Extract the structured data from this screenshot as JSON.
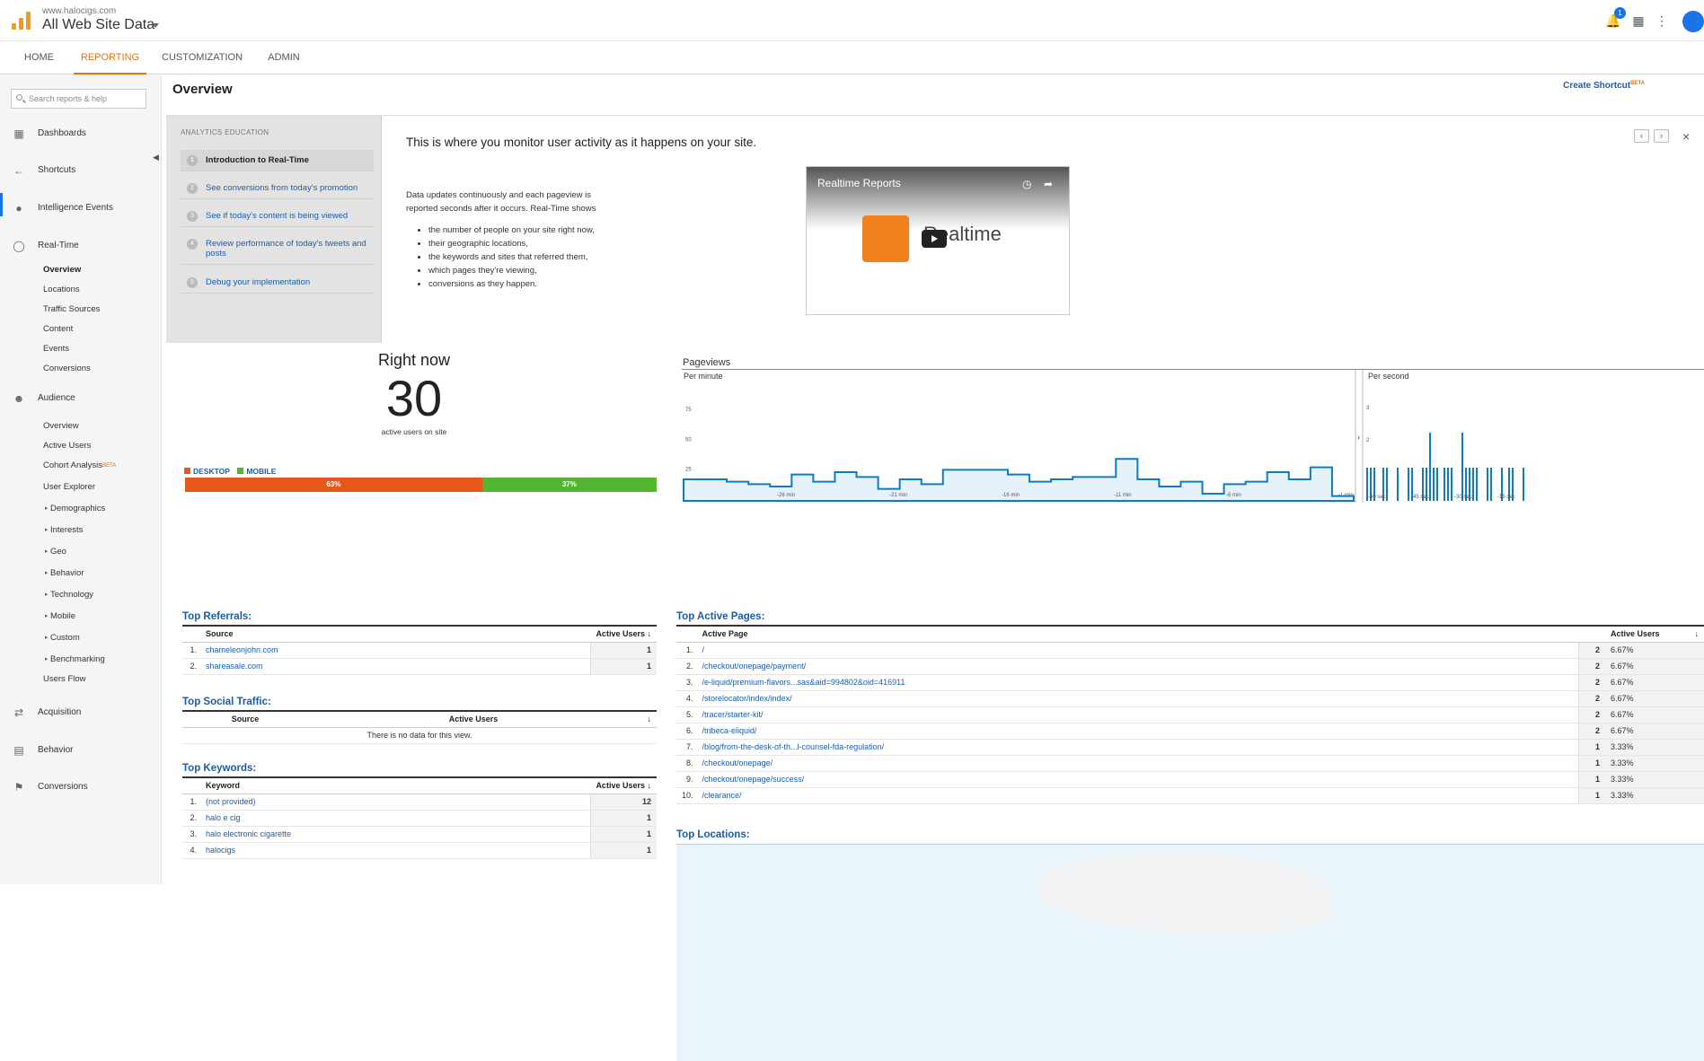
{
  "header": {
    "site_url": "www.halocigs.com",
    "property": "All Web Site Data",
    "notif_count": "1"
  },
  "tabs": [
    {
      "label": "HOME"
    },
    {
      "label": "REPORTING"
    },
    {
      "label": "CUSTOMIZATION"
    },
    {
      "label": "ADMIN"
    }
  ],
  "sidebar": {
    "search_placeholder": "Search reports & help",
    "dashboards": "Dashboards",
    "shortcuts": "Shortcuts",
    "intelligence": "Intelligence Events",
    "realtime": "Real-Time",
    "realtime_items": [
      "Overview",
      "Locations",
      "Traffic Sources",
      "Content",
      "Events",
      "Conversions"
    ],
    "audience": "Audience",
    "audience_items": [
      "Overview",
      "Active Users",
      "Cohort Analysis",
      "User Explorer",
      "Demographics",
      "Interests",
      "Geo",
      "Behavior",
      "Technology",
      "Mobile",
      "Custom",
      "Benchmarking",
      "Users Flow"
    ],
    "beta": "BETA",
    "acquisition": "Acquisition",
    "behavior": "Behavior",
    "conversions": "Conversions"
  },
  "page": {
    "title": "Overview",
    "shortcut": "Create Shortcut",
    "shortcut_beta": "BETA"
  },
  "education": {
    "header": "ANALYTICS EDUCATION",
    "steps": [
      "Introduction to Real-Time",
      "See conversions from today's promotion",
      "See if today's content is being viewed",
      "Review performance of today's tweets and posts",
      "Debug your implementation"
    ],
    "heading": "This is where you monitor user activity as it happens on your site.",
    "description": "Data updates continuously and each pageview is reported seconds after it occurs. Real-Time shows",
    "bullets": [
      "the number of people on your site right now,",
      "their geographic locations,",
      "the keywords and sites that referred them,",
      "which pages they're viewing,",
      "conversions as they happen."
    ],
    "video_title": "Realtime Reports",
    "video_brand": "Realtime"
  },
  "right_now": {
    "title": "Right now",
    "count": "30",
    "subtitle": "active users on site",
    "desktop_label": "DESKTOP",
    "mobile_label": "MOBILE",
    "desktop_pct": "63%",
    "mobile_pct": "37%",
    "desktop_share": 63
  },
  "pageviews": {
    "title": "Pageviews",
    "per_minute": "Per minute",
    "per_second": "Per second"
  },
  "chart_data": {
    "type": "area",
    "title": "Pageviews",
    "per_minute": {
      "ylim": [
        0,
        100
      ],
      "yticks": [
        "75",
        "50",
        "25"
      ],
      "xticks": [
        "-26 min",
        "-21 min",
        "-16 min",
        "-11 min",
        "-6 min",
        "-1 min"
      ],
      "values": [
        18,
        18,
        16,
        14,
        12,
        22,
        16,
        24,
        20,
        10,
        18,
        14,
        26,
        26,
        26,
        22,
        16,
        18,
        20,
        20,
        35,
        18,
        12,
        16,
        6,
        14,
        16,
        24,
        18,
        28,
        4
      ]
    },
    "per_second": {
      "yticks": [
        "3",
        "2"
      ],
      "xticks": [
        "-60 sec",
        "-45 sec",
        "-30 sec",
        "-15 sec"
      ]
    }
  },
  "referrals": {
    "title": "Top Referrals:",
    "col_source": "Source",
    "col_users": "Active Users",
    "rows": [
      {
        "idx": "1.",
        "source": "chameleonjohn.com",
        "users": "1"
      },
      {
        "idx": "2.",
        "source": "shareasale.com",
        "users": "1"
      }
    ]
  },
  "social": {
    "title": "Top Social Traffic:",
    "col_source": "Source",
    "col_users": "Active Users",
    "empty": "There is no data for this view."
  },
  "keywords": {
    "title": "Top Keywords:",
    "col_keyword": "Keyword",
    "col_users": "Active Users",
    "rows": [
      {
        "idx": "1.",
        "kw": "(not provided)",
        "users": "12"
      },
      {
        "idx": "2.",
        "kw": "halo e cig",
        "users": "1"
      },
      {
        "idx": "3.",
        "kw": "halo electronic cigarette",
        "users": "1"
      },
      {
        "idx": "4.",
        "kw": "halocigs",
        "users": "1"
      }
    ]
  },
  "pages": {
    "title": "Top Active Pages:",
    "col_page": "Active Page",
    "col_users": "Active Users",
    "rows": [
      {
        "idx": "1.",
        "page": "/",
        "users": "2",
        "pct": "6.67%"
      },
      {
        "idx": "2.",
        "page": "/checkout/onepage/payment/",
        "users": "2",
        "pct": "6.67%"
      },
      {
        "idx": "3.",
        "page": "/e-liquid/premium-flavors...sas&aid=994802&oid=416911",
        "users": "2",
        "pct": "6.67%"
      },
      {
        "idx": "4.",
        "page": "/storelocator/index/index/",
        "users": "2",
        "pct": "6.67%"
      },
      {
        "idx": "5.",
        "page": "/tracer/starter-kit/",
        "users": "2",
        "pct": "6.67%"
      },
      {
        "idx": "6.",
        "page": "/tribeca-eliquid/",
        "users": "2",
        "pct": "6.67%"
      },
      {
        "idx": "7.",
        "page": "/blog/from-the-desk-of-th...l-counsel-fda-regulation/",
        "users": "1",
        "pct": "3.33%"
      },
      {
        "idx": "8.",
        "page": "/checkout/onepage/",
        "users": "1",
        "pct": "3.33%"
      },
      {
        "idx": "9.",
        "page": "/checkout/onepage/success/",
        "users": "1",
        "pct": "3.33%"
      },
      {
        "idx": "10.",
        "page": "/clearance/",
        "users": "1",
        "pct": "3.33%"
      }
    ]
  },
  "locations": {
    "title": "Top Locations:"
  }
}
